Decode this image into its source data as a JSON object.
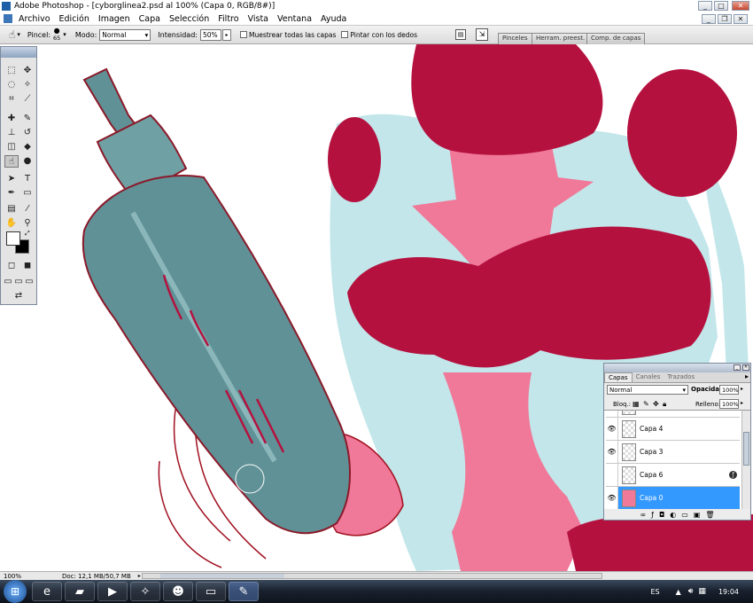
{
  "window": {
    "title": "Adobe Photoshop - [cyborglinea2.psd al 100% (Capa 0, RGB/8#)]",
    "minimize": "_",
    "maximize": "□",
    "close": "✕",
    "doc_minimize": "_",
    "doc_restore": "❐",
    "doc_close": "✕"
  },
  "menu": [
    "Archivo",
    "Edición",
    "Imagen",
    "Capa",
    "Selección",
    "Filtro",
    "Vista",
    "Ventana",
    "Ayuda"
  ],
  "options": {
    "brush_label": "Pincel:",
    "brush_size": "65",
    "mode_label": "Modo:",
    "mode_value": "Normal",
    "intensity_label": "Intensidad:",
    "intensity_value": "50%",
    "sample_all_label": "Muestrear todas las capas",
    "finger_paint_label": "Pintar con los dedos"
  },
  "panel_tabs": [
    "Pinceles",
    "Herram. preest.",
    "Comp. de capas"
  ],
  "layers": {
    "tabs": [
      "Capas",
      "Canales",
      "Trazados"
    ],
    "blend_mode": "Normal",
    "opacity_label": "Opacidad:",
    "opacity_value": "100%",
    "lock_label": "Bloq.:",
    "fill_label": "Relleno:",
    "fill_value": "100%",
    "rows": [
      {
        "name": "Capa 4"
      },
      {
        "name": "Capa 3"
      },
      {
        "name": "Capa 6"
      },
      {
        "name": "Capa 0"
      }
    ]
  },
  "status": {
    "zoom": "100%",
    "doc": "Doc: 12,1 MB/50,7 MB"
  },
  "taskbar": {
    "lang": "ES",
    "time": "19:04"
  },
  "colors": {
    "crimson": "#b5113f",
    "pink": "#f07898",
    "teal": "#5f9196",
    "light_blue": "#c2e6ea",
    "selection": "#3399ff"
  }
}
